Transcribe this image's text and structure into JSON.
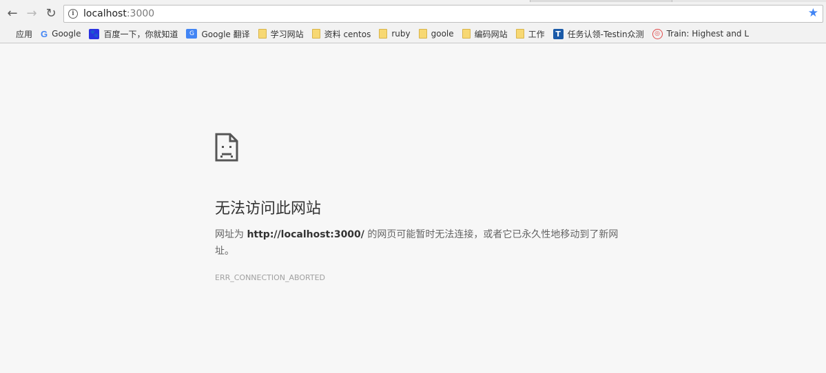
{
  "nav": {
    "back": "←",
    "forward": "→",
    "reload": "↻"
  },
  "omnibox": {
    "host": "localhost",
    "port": ":3000"
  },
  "bookmarks": [
    {
      "label": "应用",
      "icon": "apps-icon"
    },
    {
      "label": "Google",
      "icon": "google-icon"
    },
    {
      "label": "百度一下，你就知道",
      "icon": "baidu-icon"
    },
    {
      "label": "Google 翻译",
      "icon": "translate-icon"
    },
    {
      "label": "学习网站",
      "icon": "folder-icon"
    },
    {
      "label": "资料  centos",
      "icon": "folder-icon"
    },
    {
      "label": "ruby",
      "icon": "folder-icon"
    },
    {
      "label": "goole",
      "icon": "folder-icon"
    },
    {
      "label": "编码网站",
      "icon": "folder-icon"
    },
    {
      "label": "工作",
      "icon": "folder-icon"
    },
    {
      "label": "任务认领-Testin众测",
      "icon": "testin-icon"
    },
    {
      "label": "Train: Highest and L",
      "icon": "train-icon"
    }
  ],
  "error": {
    "title": "无法访问此网站",
    "desc_prefix": "网址为 ",
    "desc_url": "http://localhost:3000/",
    "desc_suffix": " 的网页可能暂时无法连接，或者它已永久性地移动到了新网址。",
    "code": "ERR_CONNECTION_ABORTED"
  },
  "colors": {
    "background": "#f7f7f7",
    "star": "#4285f4",
    "folder": "#f7d873"
  }
}
